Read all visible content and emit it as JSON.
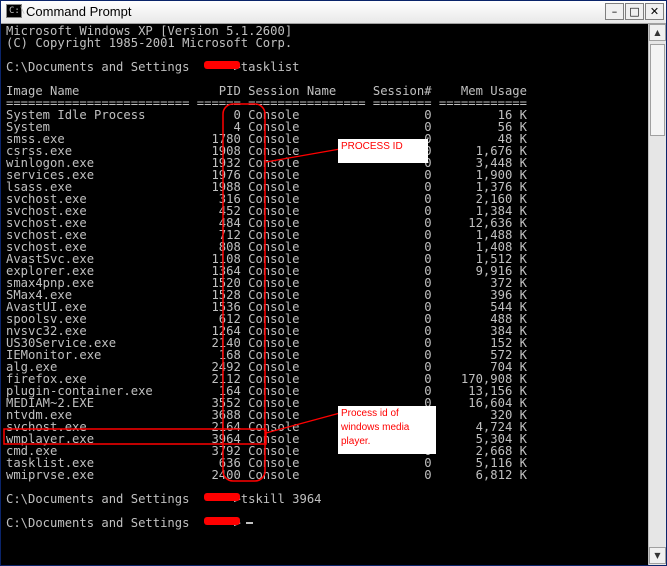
{
  "window": {
    "title": "Command Prompt",
    "icon_text": "C:\\",
    "icon": "console-icon",
    "buttons": {
      "minimize": "–",
      "maximize": "□",
      "close": "✕"
    }
  },
  "console": {
    "lines": [
      "Microsoft Windows XP [Version 5.1.2600]",
      "(C) Copyright 1985-2001 Microsoft Corp.",
      "",
      "C:\\Documents and Settings      >tasklist",
      "",
      "Image Name                   PID Session Name     Session#    Mem Usage",
      "========================= ====== ================ ======== ============",
      "System Idle Process            0 Console                 0         16 K",
      "System                         4 Console                 0         56 K",
      "smss.exe                    1780 Console                 0         48 K",
      "csrss.exe                   1908 Console                 0      1,676 K",
      "winlogon.exe                1932 Console                 0      3,448 K",
      "services.exe                1976 Console                 0      1,900 K",
      "lsass.exe                   1988 Console                 0      1,376 K",
      "svchost.exe                  316 Console                 0      2,160 K",
      "svchost.exe                  452 Console                 0      1,384 K",
      "svchost.exe                  484 Console                 0     12,636 K",
      "svchost.exe                  712 Console                 0      1,488 K",
      "svchost.exe                  808 Console                 0      1,408 K",
      "AvastSvc.exe                1108 Console                 0      1,512 K",
      "explorer.exe                1364 Console                 0      9,916 K",
      "smax4pnp.exe                1520 Console                 0        372 K",
      "SMax4.exe                   1528 Console                 0        396 K",
      "AvastUI.exe                 1536 Console                 0        544 K",
      "spoolsv.exe                  612 Console                 0        488 K",
      "nvsvc32.exe                 1264 Console                 0        384 K",
      "US30Service.exe             2140 Console                 0        152 K",
      "IEMonitor.exe                168 Console                 0        572 K",
      "alg.exe                     2492 Console                 0        704 K",
      "firefox.exe                 2112 Console                 0    170,908 K",
      "plugin-container.exe         164 Console                 0     13,156 K",
      "MEDIAM~2.EXE                3552 Console                 0     16,604 K",
      "ntvdm.exe                   3688 Console                 0        320 K",
      "svchost.exe                 2164 Console                 0      4,724 K",
      "wmplayer.exe                3964 Console                 0      5,304 K",
      "cmd.exe                     3792 Console                 0      2,668 K",
      "tasklist.exe                 636 Console                 0      5,116 K",
      "wmiprvse.exe                2400 Console                 0      6,812 K",
      "",
      "C:\\Documents and Settings      >tskill 3964",
      "",
      "C:\\Documents and Settings      >"
    ]
  },
  "annotations": {
    "process_id": "PROCESS ID",
    "wmp_pid": [
      "Process id of",
      "windows media",
      "player."
    ],
    "color": "#ff0000"
  },
  "scrollbar": {
    "up": "▲",
    "down": "▼"
  }
}
